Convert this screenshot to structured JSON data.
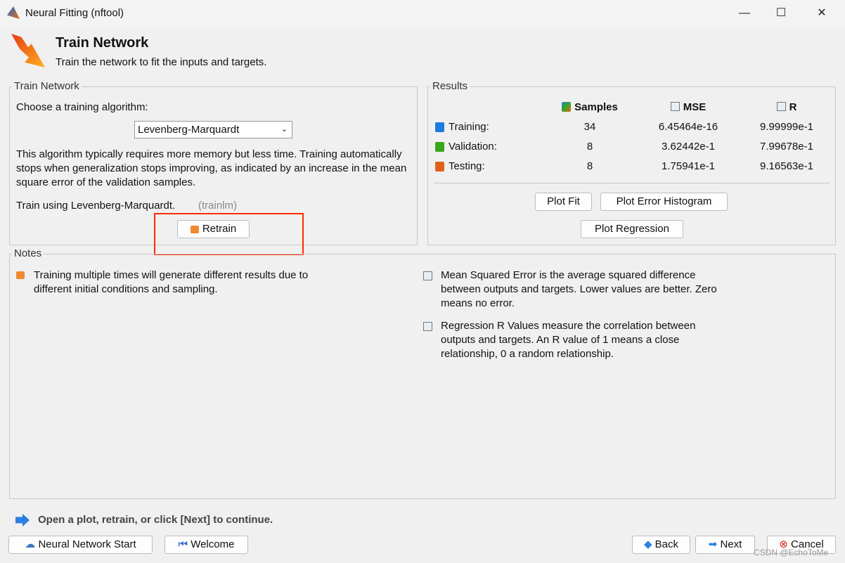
{
  "window": {
    "title": "Neural Fitting (nftool)",
    "minimize": "—",
    "maximize": "☐",
    "close": "✕"
  },
  "header": {
    "title": "Train Network",
    "subtitle": "Train the network to fit the inputs and targets."
  },
  "train": {
    "group_label": "Train Network",
    "choose_label": "Choose a training algorithm:",
    "algorithm": "Levenberg-Marquardt",
    "description": "This algorithm typically requires more memory but less time. Training automatically stops when generalization stops improving, as indicated by an increase in the mean square error of the validation samples.",
    "using": "Train using Levenberg-Marquardt.",
    "fn": "(trainlm)",
    "retrain": "Retrain",
    "highlight_color": "#ff2a00"
  },
  "results": {
    "group_label": "Results",
    "headers": [
      "Samples",
      "MSE",
      "R"
    ],
    "rows": [
      {
        "label": "Training:",
        "samples": "34",
        "mse": "6.45464e-16",
        "r": "9.99999e-1",
        "color": "#1e7be0"
      },
      {
        "label": "Validation:",
        "samples": "8",
        "mse": "3.62442e-1",
        "r": "7.99678e-1",
        "color": "#3aa81c"
      },
      {
        "label": "Testing:",
        "samples": "8",
        "mse": "1.75941e-1",
        "r": "9.16563e-1",
        "color": "#e0621a"
      }
    ],
    "plot_fit": "Plot Fit",
    "plot_hist": "Plot Error Histogram",
    "plot_reg": "Plot Regression"
  },
  "notes": {
    "group_label": "Notes",
    "note1": "Training multiple times will generate different results due to different initial conditions and sampling.",
    "note2": "Mean Squared Error is the average squared difference between outputs and targets. Lower values are better. Zero means no error.",
    "note3": "Regression R Values measure the correlation between outputs and targets. An R value of 1 means a close relationship, 0 a random relationship."
  },
  "footer": {
    "hint": "Open a plot, retrain, or click [Next] to continue.",
    "nn_start": "Neural Network Start",
    "welcome": "Welcome",
    "back": "Back",
    "next": "Next",
    "cancel": "Cancel",
    "watermark": "CSDN @EchoToMe"
  }
}
